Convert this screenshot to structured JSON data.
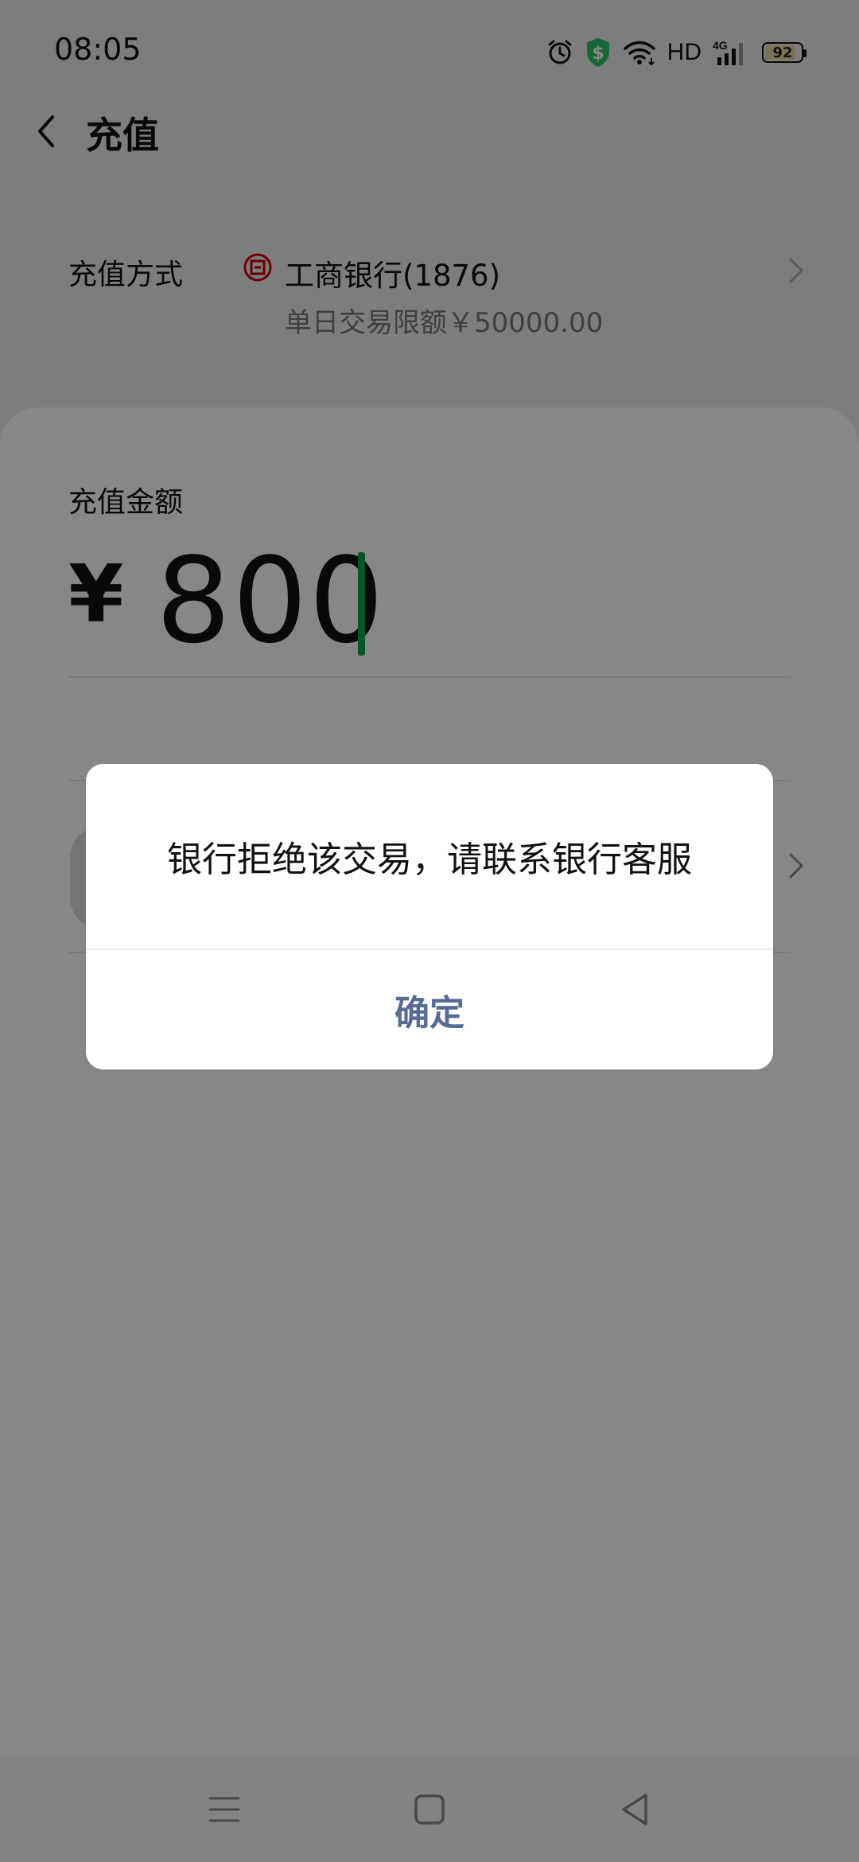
{
  "status_bar": {
    "time": "08:05",
    "network_label": "HD",
    "network_type": "4G",
    "battery_level": "92",
    "icons": [
      "alarm-icon",
      "security-shield-icon",
      "wifi-icon",
      "signal-icon",
      "battery-icon"
    ],
    "shield_color": "#2bc46b"
  },
  "header": {
    "title": "充值",
    "back_icon": "chevron-left-icon"
  },
  "recharge_method": {
    "label": "充值方式",
    "bank_name": "工商银行(1876)",
    "daily_limit": "单日交易限额￥50000.00",
    "bank_logo_color": "#c7000b"
  },
  "amount": {
    "label": "充值金额",
    "currency": "¥",
    "value": "800",
    "cursor_color": "#07a34a"
  },
  "dialog": {
    "message": "银行拒绝该交易，请联系银行客服",
    "confirm_label": "确定",
    "confirm_color": "#576b95"
  },
  "nav_bar": {
    "items": [
      "menu-icon",
      "home-icon",
      "back-triangle-icon"
    ]
  }
}
